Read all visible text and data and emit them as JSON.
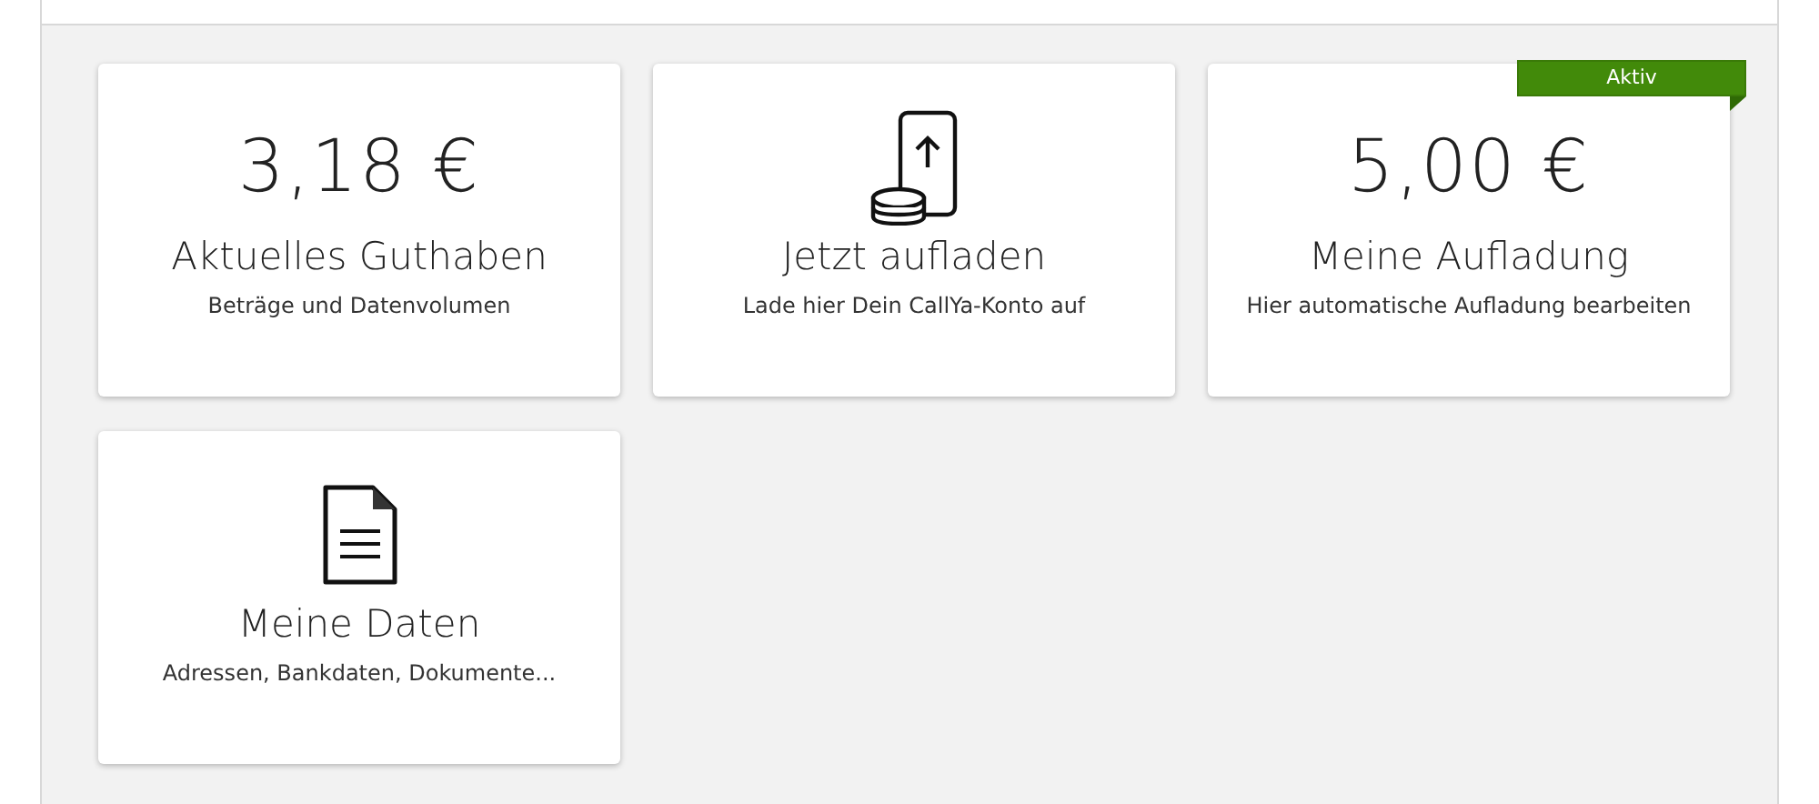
{
  "tiles": [
    {
      "kind": "amount",
      "amount": "3,18 €",
      "title": "Aktuelles Guthaben",
      "subtitle": "Beträge und Datenvolumen"
    },
    {
      "kind": "topup",
      "title": "Jetzt aufladen",
      "subtitle": "Lade hier Dein CallYa-Konto auf"
    },
    {
      "kind": "amount",
      "amount": "5,00 €",
      "title": "Meine Aufladung",
      "subtitle": "Hier automatische Aufladung bearbeiten",
      "badge": "Aktiv"
    },
    {
      "kind": "document",
      "title": "Meine Daten",
      "subtitle": "Adressen, Bankdaten, Dokumente..."
    }
  ]
}
